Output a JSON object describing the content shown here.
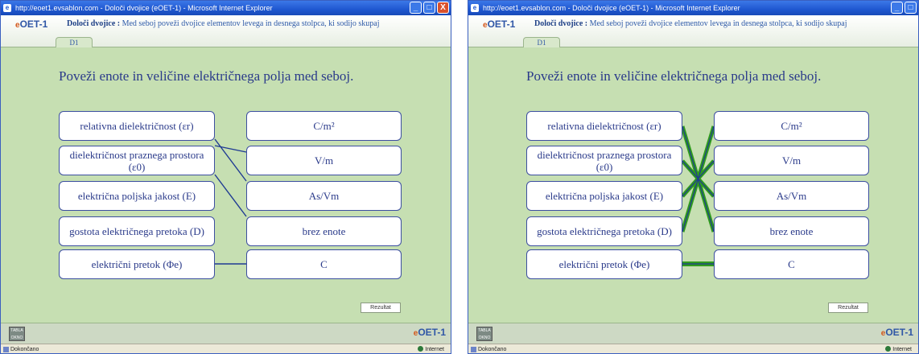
{
  "window": {
    "title": "http://eoet1.evsablon.com - Določi dvojice (eOET-1) - Microsoft Internet Explorer",
    "minimize_glyph": "_",
    "maximize_glyph": "□",
    "close_glyph": "X"
  },
  "app": {
    "logo_e": "e",
    "logo_text": "OET-1",
    "task_title": "Določi dvojice :",
    "task_description": "Med seboj poveži dvojice elementov levega in desnega stolpca, ki sodijo skupaj",
    "tab_label": "D1"
  },
  "question": "Poveži enote in veličine električnega polja med seboj.",
  "left_items": [
    "relativna dielektričnost (εr)",
    "dielektričnost praznega prostora (ε0)",
    "električna poljska jakost (E)",
    "gostota električnega pretoka (D)",
    "električni pretok (Φe)"
  ],
  "right_items": [
    "C/m²",
    "V/m",
    "As/Vm",
    "brez enote",
    "C"
  ],
  "result_button": "Rezultat",
  "footer": {
    "tabla_label": "TABLA OKNO",
    "logo_e": "e",
    "logo_text": "OET-1"
  },
  "statusbar": {
    "left": "Dokončano",
    "right": "Internet"
  },
  "colors": {
    "user_line": "#1f3a93",
    "correct_line": "#2f9a1e",
    "stage_bg": "#c6dfb2"
  }
}
